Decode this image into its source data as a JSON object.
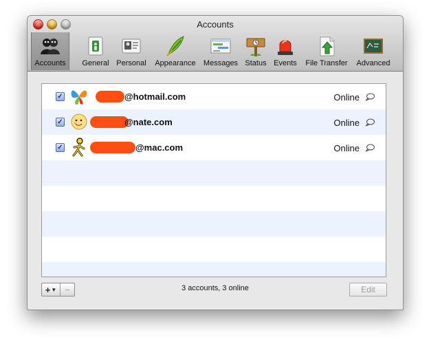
{
  "window": {
    "title": "Accounts"
  },
  "toolbar": {
    "tabs": [
      {
        "label": "Accounts",
        "icon": "two-people-icon",
        "selected": true
      },
      {
        "label": "General",
        "icon": "light-switch-icon"
      },
      {
        "label": "Personal",
        "icon": "id-card-icon"
      },
      {
        "label": "Appearance",
        "icon": "feather-icon"
      },
      {
        "label": "Messages",
        "icon": "chat-window-icon"
      },
      {
        "label": "Status",
        "icon": "wooden-sign-icon"
      },
      {
        "label": "Events",
        "icon": "siren-icon"
      },
      {
        "label": "File Transfer",
        "icon": "file-upload-icon"
      },
      {
        "label": "Advanced",
        "icon": "chalkboard-icon"
      }
    ]
  },
  "accounts": [
    {
      "service_icon": "msn-butterfly-icon",
      "email_visible": "@hotmail.com",
      "status": "Online",
      "checked": true
    },
    {
      "service_icon": "smiley-face-icon",
      "email_visible": "@nate.com",
      "status": "Online",
      "checked": true
    },
    {
      "service_icon": "aim-running-man-icon",
      "email_visible": "@mac.com",
      "status": "Online",
      "checked": true
    }
  ],
  "footer": {
    "add_label": "+",
    "remove_label": "−",
    "summary": "3 accounts, 3 online",
    "edit_label": "Edit"
  },
  "colors": {
    "row_alt": "#edf3fe",
    "redaction": "#fb4d14",
    "toolbar_selected": "#9a9a9a"
  }
}
